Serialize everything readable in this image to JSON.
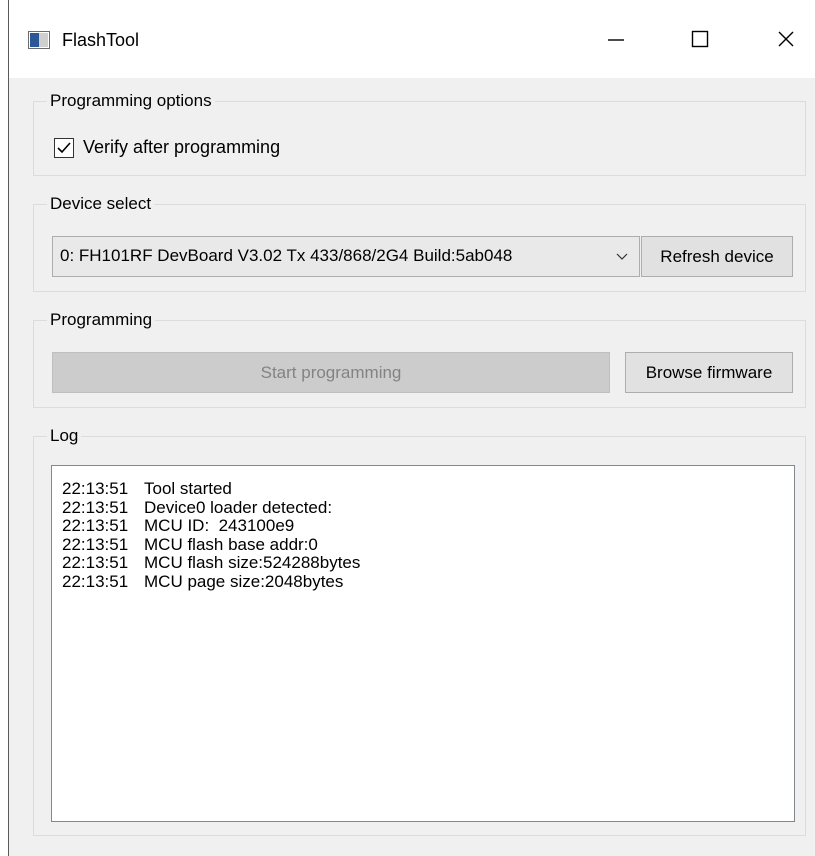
{
  "window": {
    "title": "FlashTool",
    "app_icon": "app-window-icon",
    "controls": [
      "minimize-icon",
      "maximize-icon",
      "close-icon"
    ]
  },
  "programming_options": {
    "title": "Programming options",
    "verify_label": "Verify after programming",
    "verify_checked": true
  },
  "device_select": {
    "title": "Device select",
    "selected_device": "0: FH101RF DevBoard V3.02 Tx 433/868/2G4 Build:5ab048",
    "refresh_label": "Refresh device"
  },
  "programming": {
    "title": "Programming",
    "start_label": "Start programming",
    "start_enabled": false,
    "browse_label": "Browse firmware"
  },
  "log": {
    "title": "Log",
    "entries": [
      {
        "time": "22:13:51",
        "message": "Tool started"
      },
      {
        "time": "22:13:51",
        "message": "Device0 loader detected:"
      },
      {
        "time": "22:13:51",
        "message": "MCU ID:  243100e9"
      },
      {
        "time": "22:13:51",
        "message": "MCU flash base addr:0"
      },
      {
        "time": "22:13:51",
        "message": "MCU flash size:524288bytes"
      },
      {
        "time": "22:13:51",
        "message": "MCU page size:2048bytes"
      }
    ]
  },
  "colors": {
    "window_bg": "#f0f0f0",
    "titlebar_bg": "#ffffff",
    "disabled_button_bg": "#cccccc",
    "disabled_text": "#838383"
  }
}
